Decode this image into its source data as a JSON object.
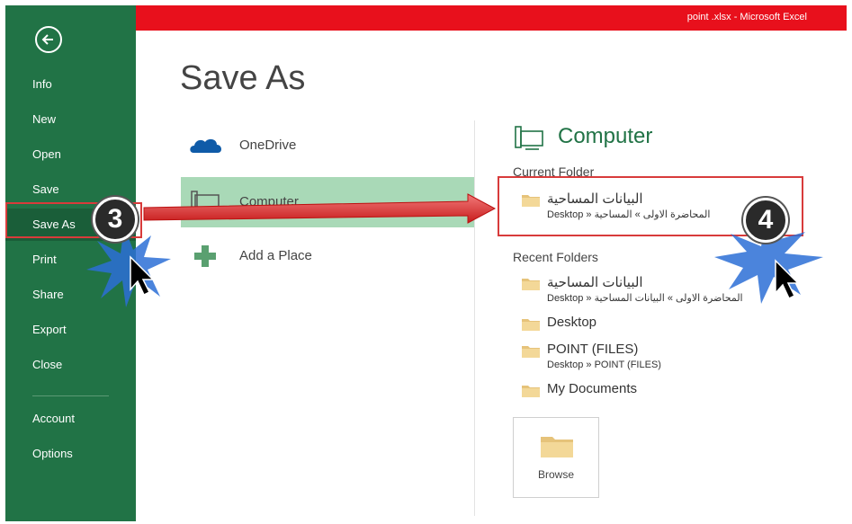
{
  "window": {
    "title": "point .xlsx - Microsoft Excel",
    "accent_color": "#217346",
    "titlebar_color": "#e8101c"
  },
  "sidebar": {
    "back_icon": "back-arrow-icon",
    "items": [
      {
        "label": "Info"
      },
      {
        "label": "New"
      },
      {
        "label": "Open"
      },
      {
        "label": "Save"
      },
      {
        "label": "Save As",
        "selected": true
      },
      {
        "label": "Print"
      },
      {
        "label": "Share"
      },
      {
        "label": "Export"
      },
      {
        "label": "Close"
      },
      {
        "label": "Account"
      },
      {
        "label": "Options"
      }
    ]
  },
  "main": {
    "title": "Save As",
    "places": [
      {
        "label": "OneDrive",
        "icon": "cloud-icon"
      },
      {
        "label": "Computer",
        "icon": "computer-icon",
        "selected": true
      },
      {
        "label": "Add a Place",
        "icon": "plus-icon"
      }
    ]
  },
  "panel": {
    "heading": "Computer",
    "heading_icon": "computer-icon",
    "current_folder_label": "Current Folder",
    "current_folder": {
      "name": "البيانات المساحية",
      "path": "Desktop » المحاضرة الاولى » المساحية"
    },
    "recent_folders_label": "Recent Folders",
    "recent_folders": [
      {
        "name": "البيانات المساحية",
        "path": "Desktop » المحاضرة الاولى » البيانات المساحية"
      },
      {
        "name": "Desktop",
        "path": ""
      },
      {
        "name": "POINT (FILES)",
        "path": "Desktop » POINT (FILES)"
      },
      {
        "name": "My Documents",
        "path": ""
      }
    ],
    "browse_label": "Browse",
    "browse_icon": "folder-icon"
  },
  "annotations": {
    "step_3": "3",
    "step_4": "4",
    "highlight_color": "#d83b3b"
  }
}
